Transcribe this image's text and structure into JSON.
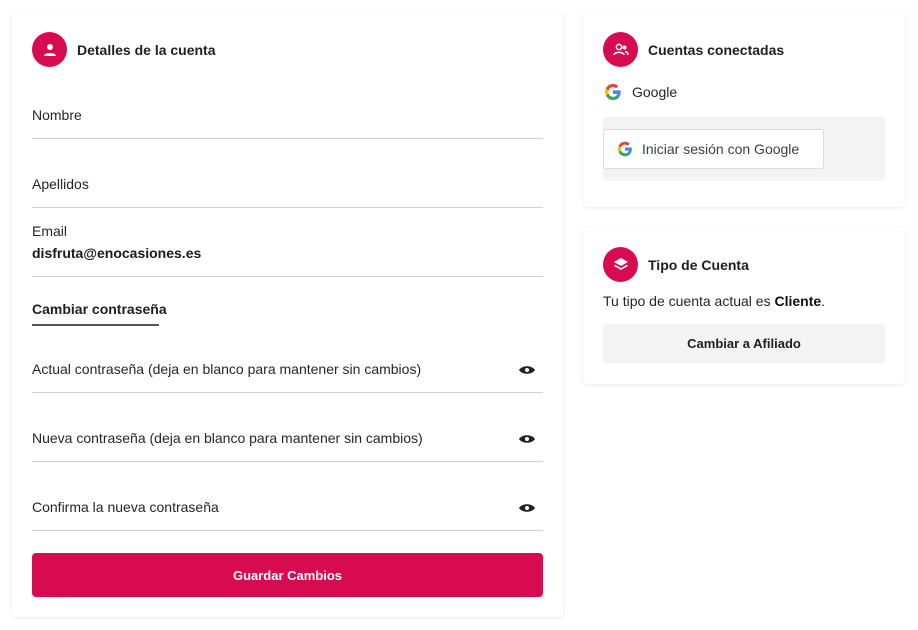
{
  "account": {
    "title": "Detalles de la cuenta",
    "icon": "user-icon",
    "fields": {
      "first_name": {
        "label": "Nombre",
        "value": ""
      },
      "last_name": {
        "label": "Apellidos",
        "value": ""
      },
      "email": {
        "label": "Email",
        "value": "disfruta@enocasiones.es"
      }
    },
    "password_tab": "Cambiar contraseña",
    "password_fields": {
      "current": {
        "label": "Actual contraseña (deja en blanco para mantener sin cambios)",
        "icon": "eye-icon"
      },
      "new": {
        "label": "Nueva contraseña (deja en blanco para mantener sin cambios)",
        "icon": "eye-icon"
      },
      "confirm": {
        "label": "Confirma la nueva contraseña",
        "icon": "eye-icon"
      }
    },
    "save_label": "Guardar Cambios"
  },
  "connected": {
    "title": "Cuentas conectadas",
    "icon": "users-icon",
    "provider": "Google",
    "signin_label": "Iniciar sesión con Google"
  },
  "account_type": {
    "title": "Tipo de Cuenta",
    "icon": "layers-icon",
    "text_prefix": "Tu tipo de cuenta actual es ",
    "current_type": "Cliente",
    "text_suffix": ".",
    "switch_label": "Cambiar a Afiliado"
  },
  "colors": {
    "accent": "#d90b50",
    "panel_bg": "#f3f3f3",
    "divider": "#cfcfcf"
  }
}
